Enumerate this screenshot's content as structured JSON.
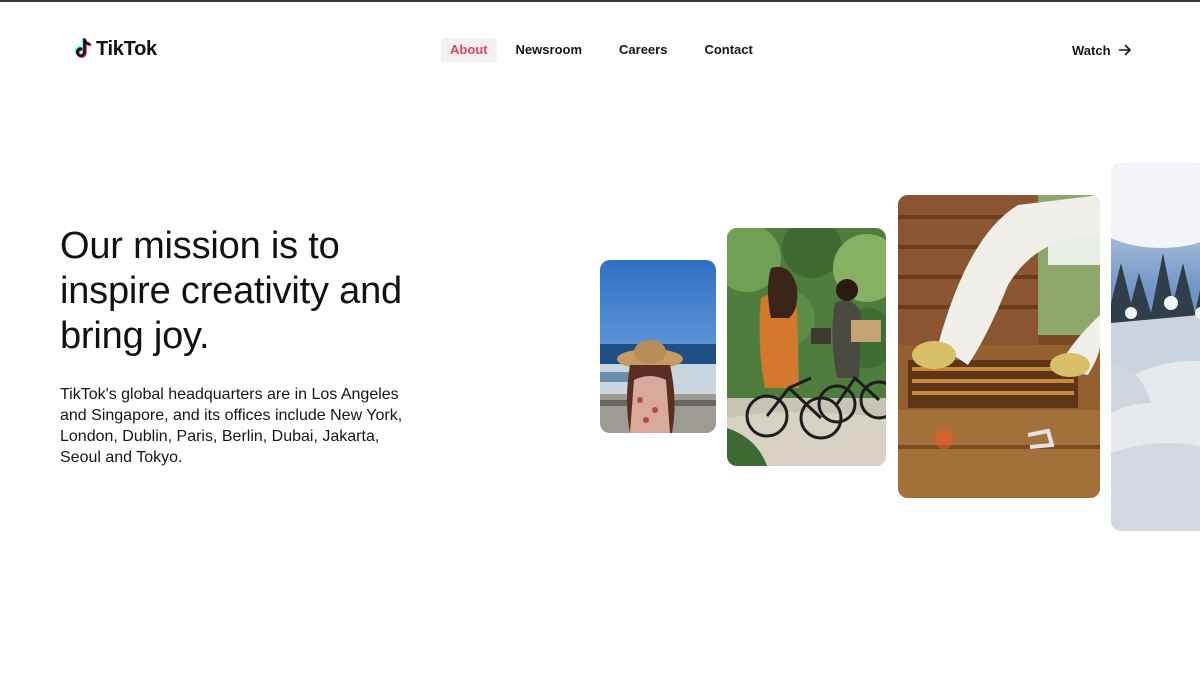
{
  "brand": {
    "name": "TikTok",
    "accent": "#e2455d",
    "logo_icon": "tiktok-note-icon"
  },
  "nav": {
    "items": [
      {
        "label": "About",
        "active": true
      },
      {
        "label": "Newsroom",
        "active": false
      },
      {
        "label": "Careers",
        "active": false
      },
      {
        "label": "Contact",
        "active": false
      }
    ],
    "watch_label": "Watch",
    "watch_icon": "arrow-right-icon"
  },
  "hero": {
    "headline": "Our mission is to inspire creativity and bring joy.",
    "description": "TikTok's global headquarters are in Los Angeles and Singapore, and its offices include New York, London, Dublin, Paris, Berlin, Dubai, Jakarta, Seoul and Tokyo."
  }
}
